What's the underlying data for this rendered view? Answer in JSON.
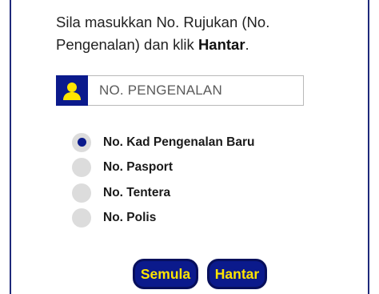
{
  "instruction": {
    "text_before": "Sila masukkan No. Rujukan (No. Pengenalan) dan klik ",
    "text_bold": "Hantar",
    "text_after": "."
  },
  "id_field": {
    "icon": "user-icon",
    "placeholder": "NO. PENGENALAN",
    "value": ""
  },
  "id_type_options": [
    {
      "label": "No. Kad Pengenalan Baru",
      "selected": true
    },
    {
      "label": "No. Pasport",
      "selected": false
    },
    {
      "label": "No. Tentera",
      "selected": false
    },
    {
      "label": "No. Polis",
      "selected": false
    }
  ],
  "buttons": {
    "reset_label": "Semula",
    "submit_label": "Hantar"
  },
  "colors": {
    "primary": "#0b1a8c",
    "button_text": "#ffe500",
    "icon_accent": "#ffe500",
    "radio_unselected": "#dcdcdc"
  }
}
